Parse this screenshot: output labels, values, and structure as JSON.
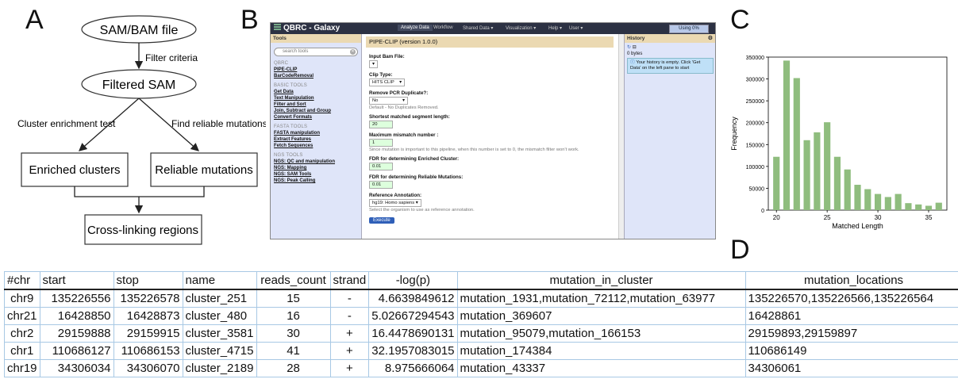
{
  "panels": {
    "a": "A",
    "b": "B",
    "c": "C",
    "d": "D"
  },
  "flowchart": {
    "input": "SAM/BAM file",
    "filter_label": "Filter criteria",
    "filtered": "Filtered SAM",
    "left_test": "Cluster enrichment test",
    "right_test": "Find reliable mutations",
    "enriched": "Enriched clusters",
    "reliable": "Reliable mutations",
    "output": "Cross-linking regions"
  },
  "galaxy": {
    "app_title": "QBRC - Galaxy",
    "nav": [
      "Analyze Data",
      "Workflow",
      "Shared Data ▾",
      "Visualization ▾",
      "Help ▾",
      "User ▾"
    ],
    "usage": "Using 0%",
    "tools_header": "Tools",
    "search_placeholder": "search tools",
    "sections": [
      {
        "title": "QBRC",
        "tools": [
          "PIPE-CLIP",
          "BarCodeRemoval"
        ]
      },
      {
        "title": "BASIC TOOLS",
        "tools": [
          "Get Data",
          "Text Manipulation",
          "Filter and Sort",
          "Join, Subtract and Group",
          "Convert Formats"
        ]
      },
      {
        "title": "FASTA TOOLS",
        "tools": [
          "FASTA manipulation",
          "Extract Features",
          "Fetch Sequences"
        ]
      },
      {
        "title": "NGS TOOLS",
        "tools": [
          "NGS: QC and manipulation",
          "NGS: Mapping",
          "NGS: SAM Tools",
          "NGS: Peak Calling"
        ]
      }
    ],
    "tool_title": "PIPE-CLIP (version 1.0.0)",
    "form": {
      "input_bam_label": "Input Bam File:",
      "input_bam_value": "",
      "clip_type_label": "Clip Type:",
      "clip_type_value": "HITS CLIP",
      "pcr_label": "Remove PCR Duplicate?:",
      "pcr_value": "No",
      "pcr_help": "Default - No Duplicates Removed.",
      "seg_len_label": "Shortest matched segment length:",
      "seg_len_value": "20",
      "mismatch_label": "Maximum mismatch number :",
      "mismatch_value": "1",
      "mismatch_help": "Since mutation is important to this pipeline, when this number is set to 0, the mismatch filter won't work.",
      "fdr_cluster_label": "FDR for determining Enriched Cluster:",
      "fdr_cluster_value": "0.01",
      "fdr_mut_label": "FDR for determining Reliable Mutations:",
      "fdr_mut_value": "0.01",
      "ref_label": "Reference Annotation:",
      "ref_value": "hg19: Homo sapiens",
      "ref_help": "Select the organism to use as reference annotation.",
      "execute": "Execute"
    },
    "history_header": "History",
    "history_size": "0 bytes",
    "history_empty": "Your history is empty. Click 'Get Data' on the left pane to start"
  },
  "chart_data": {
    "type": "bar",
    "xlabel": "Matched Length",
    "ylabel": "Frequency",
    "x": [
      20,
      21,
      22,
      23,
      24,
      25,
      26,
      27,
      28,
      29,
      30,
      31,
      32,
      33,
      34,
      35,
      36
    ],
    "values": [
      122000,
      342000,
      302000,
      160000,
      178000,
      201000,
      122000,
      93000,
      58000,
      48000,
      37000,
      30000,
      37000,
      16000,
      13000,
      10000,
      17000
    ],
    "xticks": [
      20,
      25,
      30,
      35
    ],
    "yticks": [
      0,
      50000,
      100000,
      150000,
      200000,
      250000,
      300000,
      350000
    ],
    "ylim": [
      0,
      350000
    ],
    "xlim": [
      19.2,
      36.8
    ],
    "bar_color": "#8fbd7e"
  },
  "table": {
    "headers": [
      "#chr",
      "start",
      "stop",
      "name",
      "reads_count",
      "strand",
      "-log(p)",
      "mutation_in_cluster",
      "mutation_locations"
    ],
    "rows": [
      [
        "chr9",
        "135226556",
        "135226578",
        "cluster_251",
        "15",
        "-",
        "4.6639849612",
        "mutation_1931,mutation_72112,mutation_63977",
        "135226570,135226566,135226564"
      ],
      [
        "chr21",
        "16428850",
        "16428873",
        "cluster_480",
        "16",
        "-",
        "5.02667294543",
        "mutation_369607",
        "16428861"
      ],
      [
        "chr2",
        "29159888",
        "29159915",
        "cluster_3581",
        "30",
        "+",
        "16.4478690131",
        "mutation_95079,mutation_166153",
        "29159893,29159897"
      ],
      [
        "chr1",
        "110686127",
        "110686153",
        "cluster_4715",
        "41",
        "+",
        "32.1957083015",
        "mutation_174384",
        "110686149"
      ],
      [
        "chr19",
        "34306034",
        "34306070",
        "cluster_2189",
        "28",
        "+",
        "8.975666064",
        "mutation_43337",
        "34306061"
      ]
    ]
  }
}
